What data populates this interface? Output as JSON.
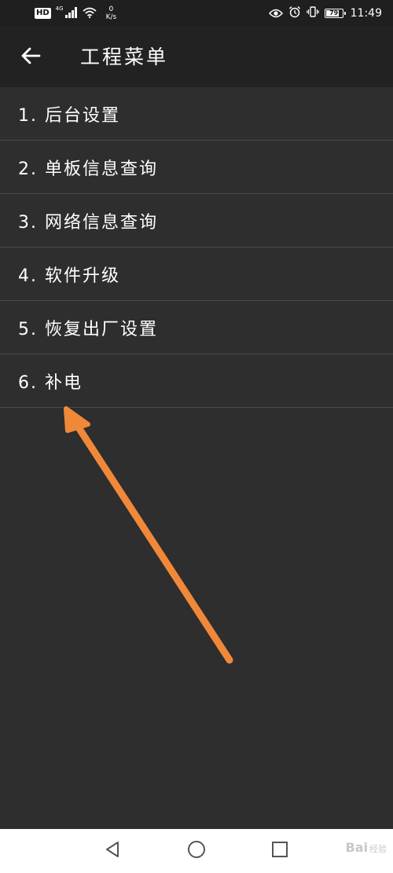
{
  "status_bar": {
    "hd": "HD",
    "signal_label": "4G",
    "net_speed_value": "0",
    "net_speed_unit": "K/s",
    "battery_level": "79",
    "battery_fraction": 0.79,
    "time": "11:49"
  },
  "header": {
    "title": "工程菜单",
    "back_icon": "arrow-left-icon"
  },
  "menu": {
    "items": [
      {
        "label": "1. 后台设置"
      },
      {
        "label": "2. 单板信息查询"
      },
      {
        "label": "3. 网络信息查询"
      },
      {
        "label": "4. 软件升级"
      },
      {
        "label": "5. 恢复出厂设置"
      },
      {
        "label": "6. 补电"
      }
    ]
  },
  "annotation": {
    "color": "#f0883a"
  },
  "nav_bar": {
    "back_icon": "triangle-back-icon",
    "home_icon": "circle-home-icon",
    "recents_icon": "square-recents-icon"
  },
  "watermark": {
    "text": "Bai",
    "sub": "经验"
  }
}
